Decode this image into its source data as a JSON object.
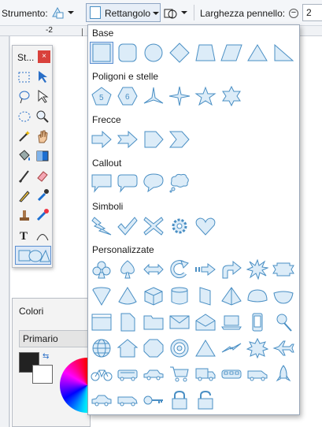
{
  "toolbar": {
    "tool_label": "Strumento:",
    "shape_label": "Rettangolo",
    "brush_label": "Larghezza pennello:",
    "brush_value": "2"
  },
  "ruler": {
    "mark": "-2"
  },
  "tools_window": {
    "title": "St...",
    "close": "×"
  },
  "colors_window": {
    "title": "Colori",
    "mode": "Primario"
  },
  "panel": {
    "categories": {
      "base": "Base",
      "poligoni": "Poligoni e stelle",
      "frecce": "Frecce",
      "callout": "Callout",
      "simboli": "Simboli",
      "personalizzate": "Personalizzate"
    },
    "polygon_labels": {
      "pentagon": "5",
      "hexagon": "6"
    }
  },
  "colors": {
    "accent": "#5b8fd1",
    "shape_stroke": "#4a8fc4",
    "shape_fill": "#dcecf8"
  }
}
